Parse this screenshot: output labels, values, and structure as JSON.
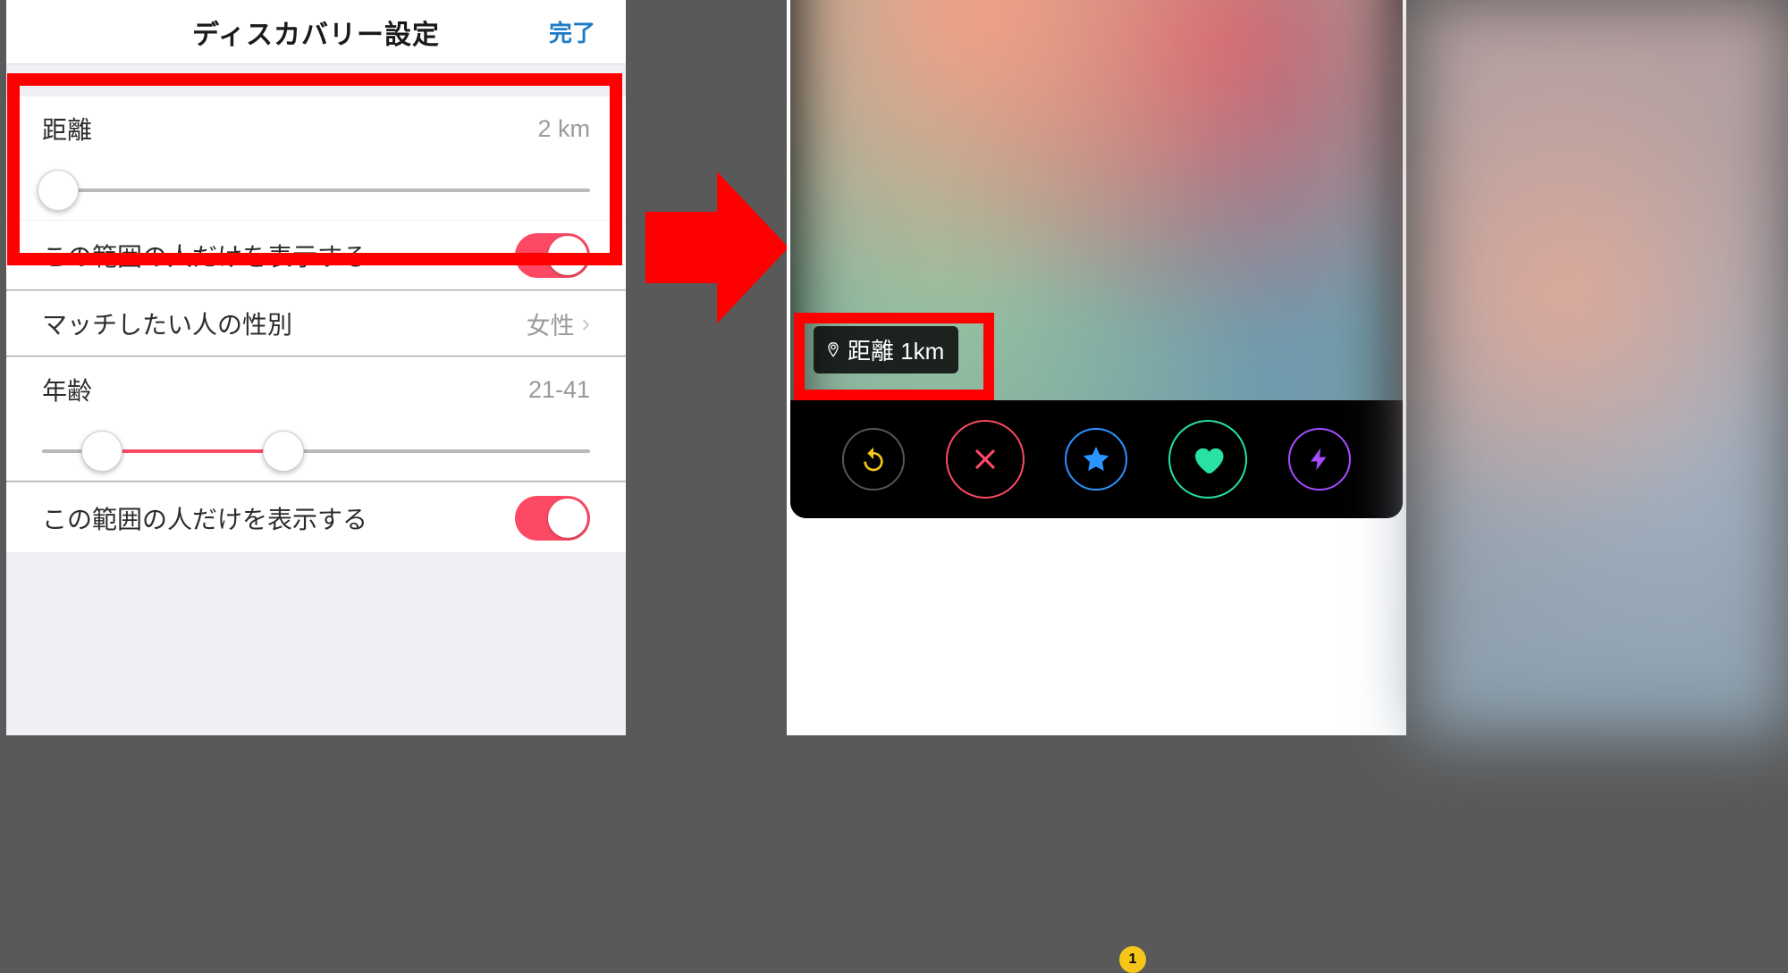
{
  "left": {
    "header": {
      "title": "ディスカバリー設定",
      "done": "完了"
    },
    "distance": {
      "label": "距離",
      "value": "2 km"
    },
    "range_only_toggle_truncated": "この範囲の人だけを表示する",
    "gender": {
      "label": "マッチしたい人の性別",
      "value": "女性"
    },
    "age": {
      "label": "年齢",
      "value": "21-41"
    },
    "range_only_toggle": "この範囲の人だけを表示する"
  },
  "right": {
    "distance_chip": "距離 1km",
    "badge": "1"
  }
}
